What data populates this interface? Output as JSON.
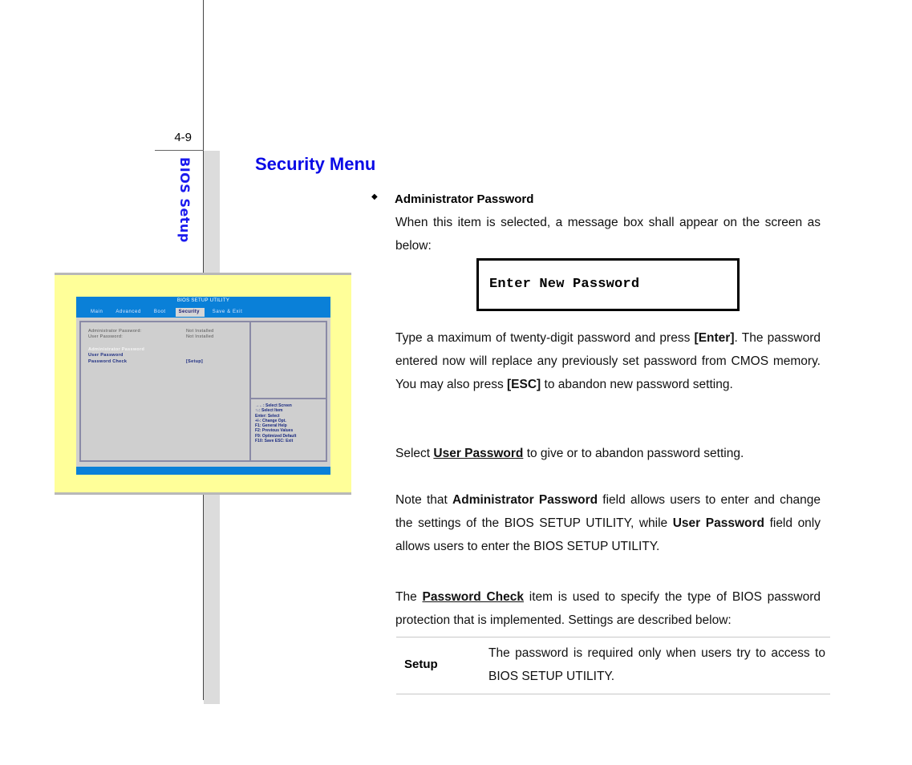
{
  "page": {
    "number": "4-9",
    "side_label": "BIOS Setup",
    "section_title": "Security Menu"
  },
  "bios_screenshot": {
    "title": "BIOS SETUP UTILITY",
    "tabs": [
      {
        "label": "Main",
        "active": false
      },
      {
        "label": "Advanced",
        "active": false
      },
      {
        "label": "Boot",
        "active": false
      },
      {
        "label": "Security",
        "active": true
      },
      {
        "label": "Save & Exit",
        "active": false
      }
    ],
    "status_rows": [
      {
        "label": "Administrator Password:",
        "value": "Not Installed"
      },
      {
        "label": "User Password:",
        "value": "Not Installed"
      }
    ],
    "menu_items": [
      {
        "label": "Administrator Password",
        "value": "",
        "selected": true
      },
      {
        "label": "User Password",
        "value": "",
        "selected": false
      },
      {
        "label": "Password Check",
        "value": "[Setup]",
        "selected": false
      }
    ],
    "help_lines": [
      "→←: Select Screen",
      "↑↓: Select Item",
      "Enter: Select",
      "+/-: Change Opt.",
      "F1: General Help",
      "F2: Previous Values",
      "F9: Optimized Default",
      "F10: Save    ESC: Exit"
    ],
    "colors": {
      "frame_bg": "#ffff99",
      "header_blue": "#0a80d8",
      "panel_gray": "#cfcfcf"
    }
  },
  "content": {
    "bullet_icon": "diamond-bullet",
    "item_heading": "Administrator Password",
    "p1": "When this item is selected, a message box shall appear on the screen as below:",
    "message_box": "Enter New Password",
    "p2": {
      "t1": "Type a maximum of twenty-digit password and press ",
      "b1": "[Enter]",
      "t2": ".  The password entered now will replace any previously set password from CMOS memory. You may also press ",
      "b2": "[ESC]",
      "t3": " to abandon new password setting."
    },
    "p3": {
      "t1": "Select ",
      "link": "User Password",
      "t2": " to give or to abandon password setting."
    },
    "p4": {
      "t1": "Note that ",
      "b1": "Administrator Password",
      "t2": " field allows users to enter and change the settings of the BIOS SETUP UTILITY, while ",
      "b2": "User Password",
      "t3": " field only allows users to enter the BIOS SETUP UTILITY."
    },
    "p5": {
      "t1": "The ",
      "link": "Password Check",
      "t2": " item is used to specify the type of BIOS password protection that is implemented.   Settings are described below:"
    },
    "settings_table": [
      {
        "key": "Setup",
        "description": "The password is required only when users try to access to BIOS SETUP UTILITY."
      }
    ]
  },
  "colors": {
    "title_blue": "#0a0ae6",
    "side_label_blue": "#1a1aee",
    "margin_band": "#dcdcdc"
  }
}
